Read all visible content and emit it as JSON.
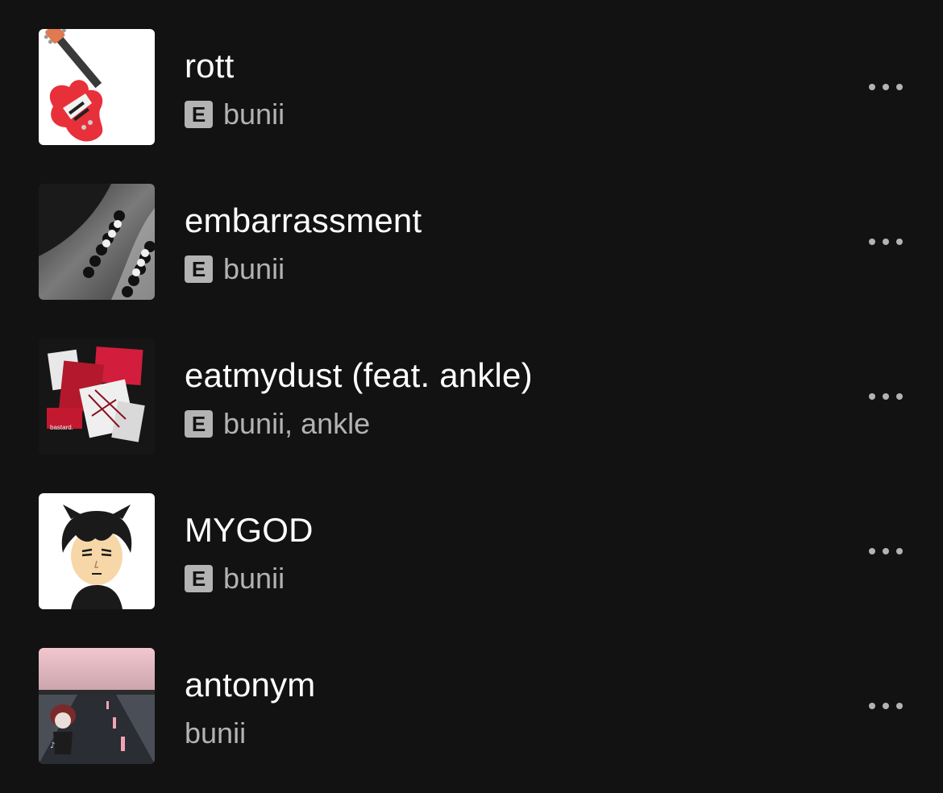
{
  "tracks": [
    {
      "title": "rott",
      "explicit_badge": "E",
      "explicit": true,
      "artist": "bunii",
      "art_icon": "electric-guitar-art"
    },
    {
      "title": "embarrassment",
      "explicit_badge": "E",
      "explicit": true,
      "artist": "bunii",
      "art_icon": "beaded-bracelet-photo-art"
    },
    {
      "title": "eatmydust (feat. ankle)",
      "explicit_badge": "E",
      "explicit": true,
      "artist": "bunii, ankle",
      "art_icon": "red-collage-art",
      "art_text": "bastard."
    },
    {
      "title": "MYGOD",
      "explicit_badge": "E",
      "explicit": true,
      "artist": "bunii",
      "art_icon": "cartoon-avatar-art"
    },
    {
      "title": "antonym",
      "explicit": false,
      "artist": "bunii",
      "art_icon": "road-illustration-art"
    }
  ],
  "colors": {
    "background": "#121212",
    "primary_text": "#ffffff",
    "secondary_text": "#b3b3b3",
    "explicit_badge_bg": "#b3b3b3"
  },
  "icons": {
    "more": "more-options-icon"
  }
}
